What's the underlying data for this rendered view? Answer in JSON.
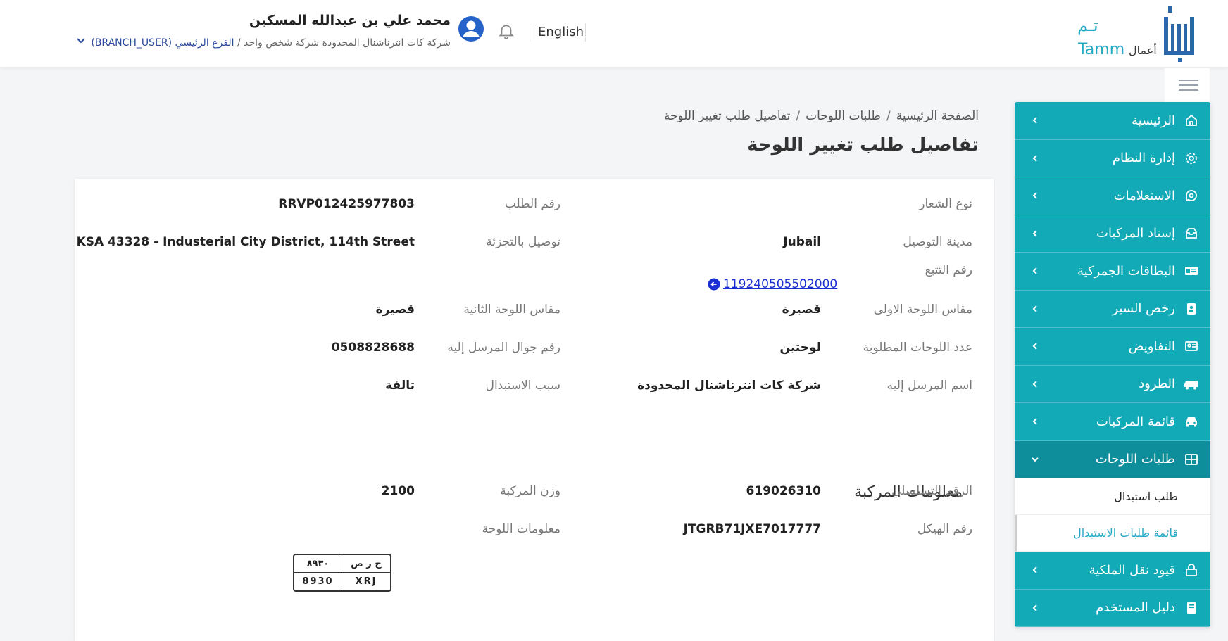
{
  "header": {
    "logo_amal": "أعمال",
    "logo_tamm_ar": "تـم",
    "logo_tamm_en": "Tamm",
    "language_link": "English",
    "user_name": "محمد علي بن عبدالله المسكين",
    "user_company": "شركة كات انترناشنال المحدودة شركة شخص واحد",
    "user_sep": "/",
    "user_branch": "الفرع الرئيسي (BRANCH_USER)"
  },
  "sidebar": {
    "items": [
      {
        "label": "الرئيسية",
        "icon": "home-icon"
      },
      {
        "label": "إدارة النظام",
        "icon": "gear-icon"
      },
      {
        "label": "الاستعلامات",
        "icon": "search-chat-icon"
      },
      {
        "label": "إسناد المركبات",
        "icon": "inbox-icon"
      },
      {
        "label": "البطاقات الجمركية",
        "icon": "id-card-icon"
      },
      {
        "label": "رخص السير",
        "icon": "license-icon"
      },
      {
        "label": "التفاويض",
        "icon": "contact-card-icon"
      },
      {
        "label": "الطرود",
        "icon": "truck-icon"
      },
      {
        "label": "قائمة المركبات",
        "icon": "car-icon"
      },
      {
        "label": "طلبات اللوحات",
        "icon": "grid-icon"
      },
      {
        "label": "قيود نقل الملكية",
        "icon": "lock-icon"
      },
      {
        "label": "دليل المستخدم",
        "icon": "book-icon"
      }
    ],
    "sub_items": [
      {
        "label": "طلب استبدال"
      },
      {
        "label": "قائمة طلبات الاستبدال"
      }
    ]
  },
  "breadcrumb": {
    "home": "الصفحة الرئيسية",
    "sep": "/",
    "plates": "طلبات اللوحات",
    "current": "تفاصيل طلب تغيير اللوحة"
  },
  "page_title": "تفاصيل طلب تغيير اللوحة",
  "details": {
    "logo_type_label": "نوع الشعار",
    "logo_type_value": "",
    "request_no_label": "رقم الطلب",
    "request_no_value": "RRVP012425977803",
    "delivery_city_label": "مدينة التوصيل",
    "delivery_city_value": "Jubail",
    "retail_delivery_label": "توصيل بالتجزئة",
    "retail_delivery_value": "KSA 43328 - Industerial City District, 114th Street",
    "tracking_label": "رقم التتبع",
    "tracking_value": "119240505502000",
    "first_plate_size_label": "مقاس اللوحة الاولى",
    "first_plate_size_value": "قصيرة",
    "second_plate_size_label": "مقاس اللوحة الثانية",
    "second_plate_size_value": "قصيرة",
    "plates_count_label": "عدد اللوحات المطلوبة",
    "plates_count_value": "لوحتين",
    "recipient_mobile_label": "رقم جوال المرسل إليه",
    "recipient_mobile_value": "0508828688",
    "recipient_name_label": "اسم المرسل إليه",
    "recipient_name_value": "شركة كات انترناشنال المحدودة",
    "replace_reason_label": "سبب الاستبدال",
    "replace_reason_value": "تالفة"
  },
  "vehicle": {
    "section_title": "معلومات المركبة",
    "serial_label": "الرقم التسلسلي",
    "serial_value": "619026310",
    "weight_label": "وزن المركبة",
    "weight_value": "2100",
    "chassis_label": "رقم الهيكل",
    "chassis_value": "JTGRB71JXE7017777",
    "plate_info_label": "معلومات اللوحة",
    "plate": {
      "ar_digits": "٨٩٣٠",
      "ar_letters": "ح ر ص",
      "en_digits": "8930",
      "en_letters": "XRJ"
    }
  },
  "colors": {
    "brand": "#13aab8",
    "brand_active": "#0e8e9b",
    "logo": "#24a9c5",
    "link": "#1a2fd1"
  }
}
